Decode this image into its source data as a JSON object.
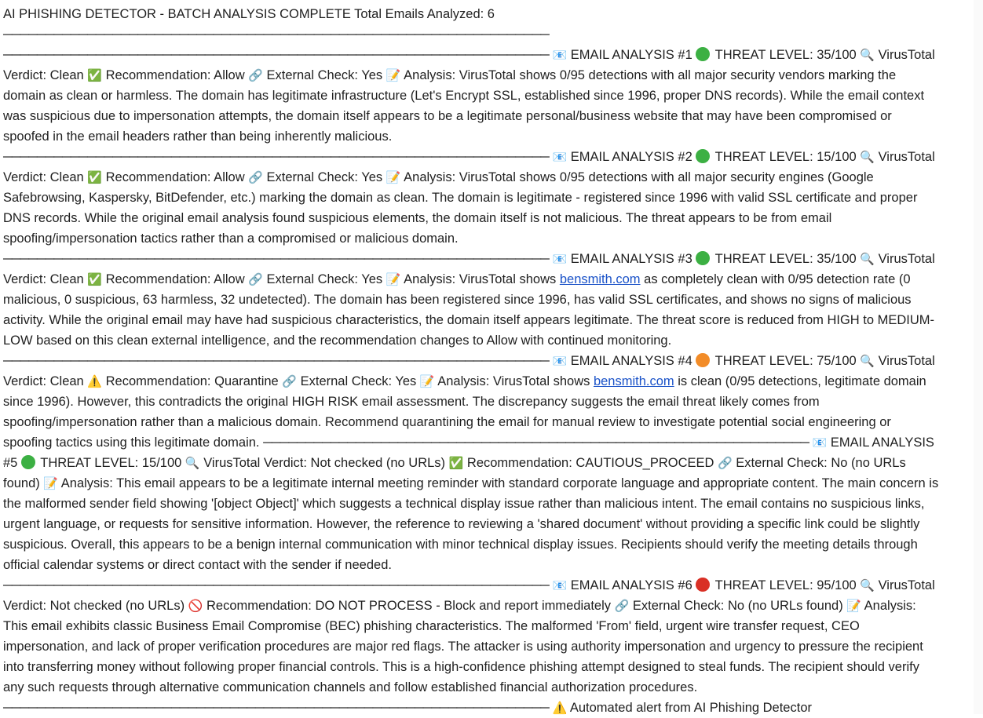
{
  "header": {
    "title": "AI PHISHING DETECTOR - BATCH ANALYSIS COMPLETE",
    "total": "Total Emails Analyzed: 6"
  },
  "rule": "─────────────────────────────────────────────────────────────────",
  "icons": {
    "envelope": "📧",
    "search": "🔍",
    "link": "🔗",
    "memo": "📝",
    "check": "✅",
    "warning": "⚠️",
    "prohibited": "🚫"
  },
  "colors": {
    "green": "#3cb043",
    "orange": "#f28c28",
    "red": "#d93025",
    "link": "#1a52c8"
  },
  "emails": [
    {
      "heading": "EMAIL ANALYSIS #1",
      "level_color": "green",
      "threat": "THREAT LEVEL: 35/100",
      "verdict": "VirusTotal Verdict: Clean",
      "rec_icon": "check",
      "recommendation": "Recommendation: Allow",
      "external": "External Check: Yes",
      "analysis": "Analysis: VirusTotal shows 0/95 detections with all major security vendors marking the domain as clean or harmless. The domain has legitimate infrastructure (Let's Encrypt SSL, established since 1996, proper DNS records). While the email context was suspicious due to impersonation attempts, the domain itself appears to be a legitimate personal/business website that may have been compromised or spoofed in the email headers rather than being inherently malicious."
    },
    {
      "heading": "EMAIL ANALYSIS #2",
      "level_color": "green",
      "threat": "THREAT LEVEL: 15/100",
      "verdict": "VirusTotal Verdict: Clean",
      "rec_icon": "check",
      "recommendation": "Recommendation: Allow",
      "external": "External Check: Yes",
      "analysis": "Analysis: VirusTotal shows 0/95 detections with all major security engines (Google Safebrowsing, Kaspersky, BitDefender, etc.) marking the domain as clean. The domain is legitimate - registered since 1996 with valid SSL certificate and proper DNS records. While the original email analysis found suspicious elements, the domain itself is not malicious. The threat appears to be from email spoofing/impersonation tactics rather than a compromised or malicious domain."
    },
    {
      "heading": "EMAIL ANALYSIS #3",
      "level_color": "green",
      "threat": "THREAT LEVEL: 35/100",
      "verdict": "VirusTotal Verdict: Clean",
      "rec_icon": "check",
      "recommendation": "Recommendation: Allow",
      "external": "External Check: Yes",
      "analysis_pre": "Analysis: VirusTotal shows",
      "analysis_link": "bensmith.com",
      "analysis_post": "as completely clean with 0/95 detection rate (0 malicious, 0 suspicious, 63 harmless, 32 undetected). The domain has been registered since 1996, has valid SSL certificates, and shows no signs of malicious activity. While the original email may have had suspicious characteristics, the domain itself appears legitimate. The threat score is reduced from HIGH to MEDIUM-LOW based on this clean external intelligence, and the recommendation changes to Allow with continued monitoring."
    },
    {
      "heading": "EMAIL ANALYSIS #4",
      "level_color": "orange",
      "threat": "THREAT LEVEL: 75/100",
      "verdict": "VirusTotal Verdict: Clean",
      "rec_icon": "warning",
      "recommendation": "Recommendation: Quarantine",
      "external": "External Check: Yes",
      "analysis_pre": "Analysis: VirusTotal shows",
      "analysis_link": "bensmith.com",
      "analysis_post": "is clean (0/95 detections, legitimate domain since 1996). However, this contradicts the original HIGH RISK email assessment. The discrepancy suggests the email threat likely comes from spoofing/impersonation rather than a malicious domain. Recommend quarantining the email for manual review to investigate potential social engineering or spoofing tactics using this legitimate domain."
    },
    {
      "heading": "EMAIL ANALYSIS #5",
      "level_color": "green",
      "threat": "THREAT LEVEL: 15/100",
      "verdict": "VirusTotal Verdict: Not checked (no URLs)",
      "rec_icon": "check",
      "recommendation": "Recommendation: CAUTIOUS_PROCEED",
      "external": "External Check: No (no URLs found)",
      "analysis": "Analysis: This email appears to be a legitimate internal meeting reminder with standard corporate language and appropriate content. The main concern is the malformed sender field showing '[object Object]' which suggests a technical display issue rather than malicious intent. The email contains no suspicious links, urgent language, or requests for sensitive information. However, the reference to reviewing a 'shared document' without providing a specific link could be slightly suspicious. Overall, this appears to be a benign internal communication with minor technical display issues. Recipients should verify the meeting details through official calendar systems or direct contact with the sender if needed."
    },
    {
      "heading": "EMAIL ANALYSIS #6",
      "level_color": "red",
      "threat": "THREAT LEVEL: 95/100",
      "verdict": "VirusTotal Verdict: Not checked (no URLs)",
      "rec_icon": "prohibited",
      "recommendation": "Recommendation: DO NOT PROCESS - Block and report immediately",
      "external": "External Check: No (no URLs found)",
      "analysis": "Analysis: This email exhibits classic Business Email Compromise (BEC) phishing characteristics. The malformed 'From' field, urgent wire transfer request, CEO impersonation, and lack of proper verification procedures are major red flags. The attacker is using authority impersonation and urgency to pressure the recipient into transferring money without following proper financial controls. This is a high-confidence phishing attempt designed to steal funds. The recipient should verify any such requests through alternative communication channels and follow established financial authorization procedures."
    }
  ],
  "footer": {
    "text": "Automated alert from AI Phishing Detector"
  }
}
